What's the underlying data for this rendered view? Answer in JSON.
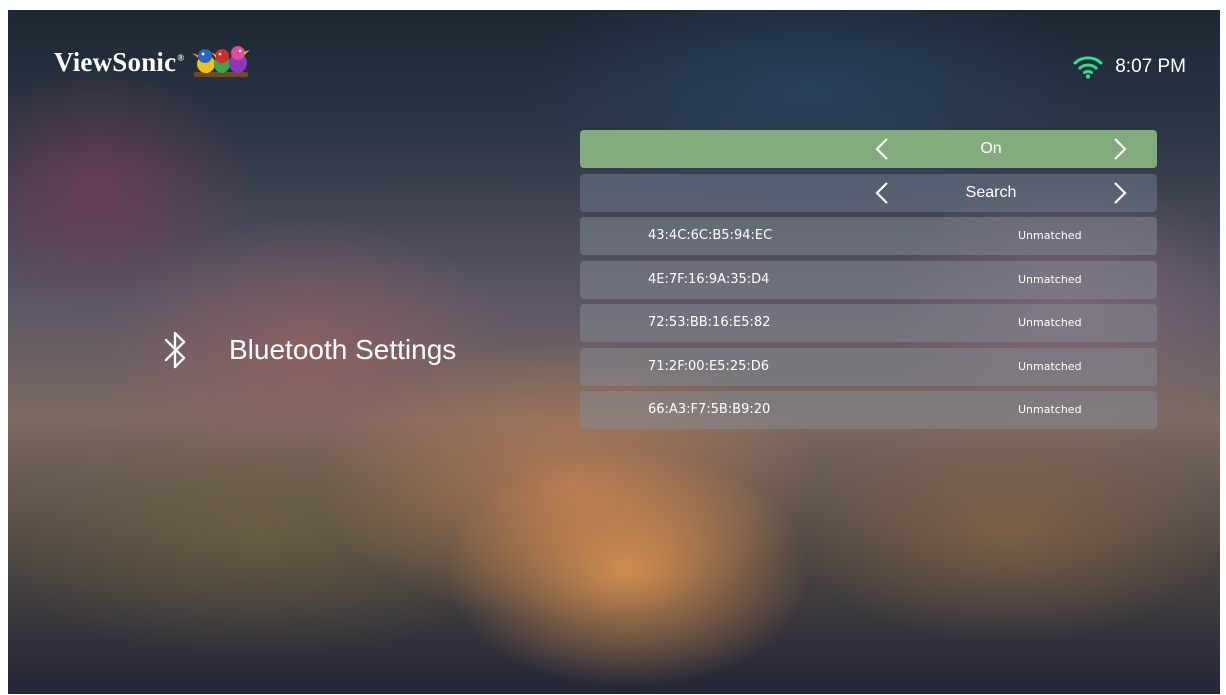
{
  "brand": {
    "name": "ViewSonic",
    "reg_mark": "®"
  },
  "status_bar": {
    "time": "8:07 PM",
    "wifi_icon": "wifi-icon",
    "wifi_color": "#2ee08b"
  },
  "page": {
    "title": "Bluetooth Settings",
    "icon": "bluetooth-icon"
  },
  "settings": {
    "power": {
      "value": "On"
    },
    "action": {
      "value": "Search"
    }
  },
  "devices": [
    {
      "address": "43:4C:6C:B5:94:EC",
      "status": "Unmatched"
    },
    {
      "address": "4E:7F:16:9A:35:D4",
      "status": "Unmatched"
    },
    {
      "address": "72:53:BB:16:E5:82",
      "status": "Unmatched"
    },
    {
      "address": "71:2F:00:E5:25:D6",
      "status": "Unmatched"
    },
    {
      "address": "66:A3:F7:5B:B9:20",
      "status": "Unmatched"
    }
  ],
  "colors": {
    "selected_row": "#84ab7e",
    "text": "#ffffff"
  }
}
